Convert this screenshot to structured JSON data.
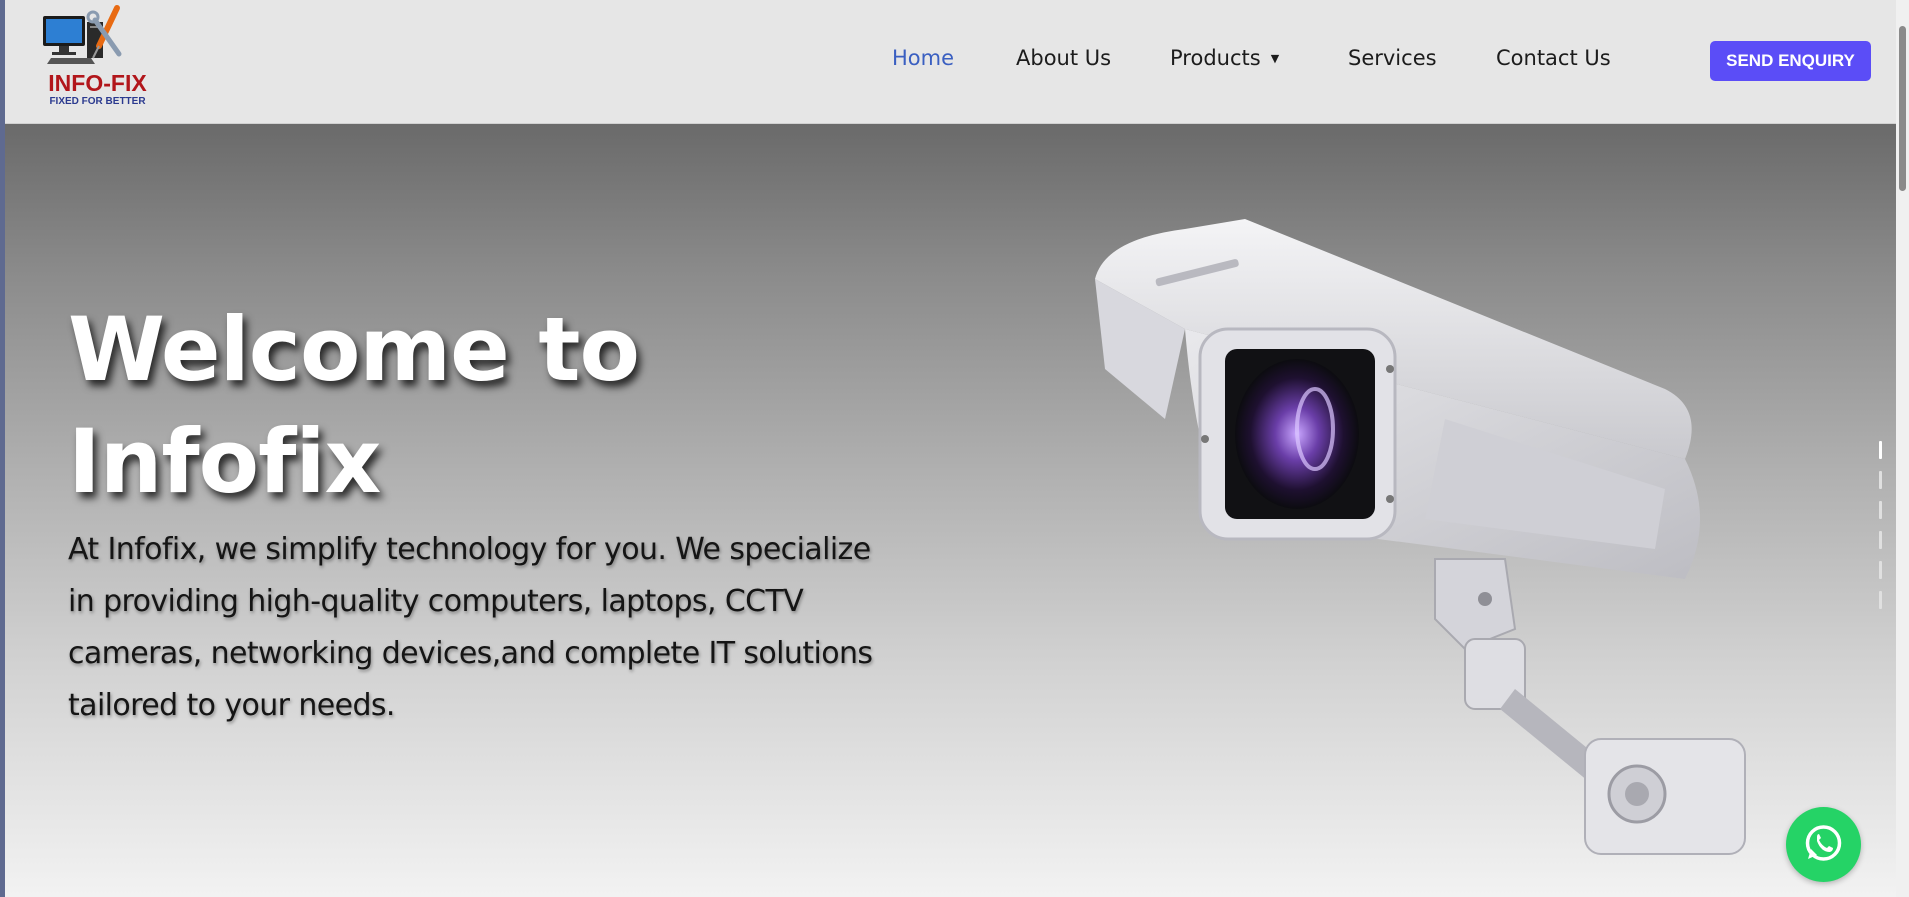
{
  "brand": {
    "name": "INFO-FIX",
    "tagline": "FIXED FOR BETTER"
  },
  "nav": {
    "items": [
      {
        "label": "Home",
        "active": true
      },
      {
        "label": "About Us",
        "active": false
      },
      {
        "label": "Products",
        "active": false,
        "has_dropdown": true
      },
      {
        "label": "Services",
        "active": false
      },
      {
        "label": "Contact Us",
        "active": false
      }
    ],
    "cta_label": "SEND ENQUIRY"
  },
  "hero": {
    "title_line1": "Welcome to",
    "title_line2": "Infofix",
    "description_lines": [
      "At Infofix, we simplify technology for you. We specialize",
      "in providing high-quality computers, laptops, CCTV",
      "cameras, networking devices,and complete IT solutions",
      "tailored to your needs."
    ],
    "image": "cctv-camera"
  },
  "slider": {
    "slide_count": 6,
    "active_index": 0
  },
  "floating": {
    "icon": "whatsapp-icon"
  },
  "colors": {
    "header_bg": "#e6e6e6",
    "nav_active": "#3a5fc1",
    "cta_bg": "#5b4df7",
    "whatsapp": "#25d366",
    "logo_red": "#b2161b",
    "logo_blue": "#2b3a8f"
  }
}
